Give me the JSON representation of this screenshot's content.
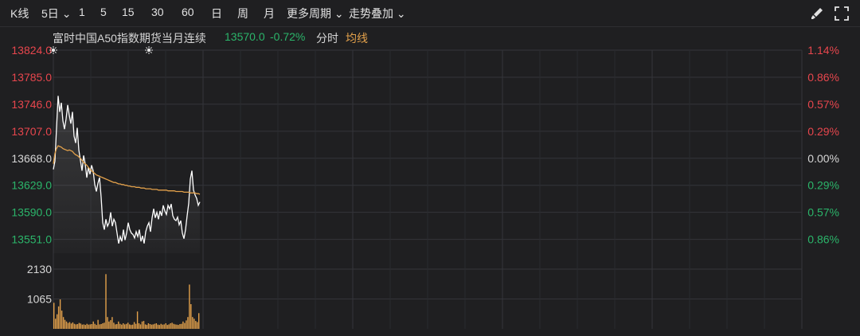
{
  "toolbar": {
    "items": [
      {
        "label": "K线"
      },
      {
        "label": "5日",
        "chevron": true
      },
      {
        "label": "1"
      },
      {
        "label": "5"
      },
      {
        "label": "15"
      },
      {
        "label": "30"
      },
      {
        "label": "60"
      },
      {
        "label": "日"
      },
      {
        "label": "周"
      },
      {
        "label": "月"
      },
      {
        "label": "更多周期",
        "chevron": true
      },
      {
        "label": "走势叠加",
        "chevron": true
      }
    ],
    "icons": [
      "brush-icon",
      "fullscreen-icon"
    ]
  },
  "info": {
    "instrument": "富时中国A50指数期货当月连续",
    "price": "13570.0",
    "change": "-0.72%",
    "mode": "分时",
    "ma_label": "均线"
  },
  "colors": {
    "background": "#1f1f21",
    "grid": "#34353a",
    "up": "#e7464d",
    "down": "#2bb56a",
    "price_line": "#ffffff",
    "avg_line": "#e3a14b",
    "volume": "#e3a14b",
    "text": "#d6d6d6"
  },
  "chart_data": {
    "type": "line",
    "price_axis": {
      "ticks": [
        "13824.0",
        "13785.0",
        "13746.0",
        "13707.0",
        "13668.0",
        "13629.0",
        "13590.0",
        "13551.0"
      ],
      "range": [
        13531.0,
        13824.0
      ],
      "prev_close": 13668.0
    },
    "percent_axis": {
      "ticks": [
        "1.14%",
        "0.86%",
        "0.57%",
        "0.29%",
        "0.00%",
        "0.29%",
        "0.57%",
        "0.86%"
      ]
    },
    "volume_axis": {
      "ticks": [
        "2130",
        "1065"
      ],
      "max": 2130
    },
    "sessions": 5,
    "series": [
      {
        "values": [
          13652,
          13664,
          13712,
          13758,
          13735,
          13748,
          13722,
          13710,
          13725,
          13745,
          13730,
          13718,
          13735,
          13700,
          13690,
          13712,
          13680,
          13665,
          13650,
          13672,
          13660,
          13640,
          13655,
          13645,
          13658,
          13650,
          13630,
          13620,
          13632,
          13640,
          13612,
          13575,
          13565,
          13580,
          13570,
          13575,
          13590,
          13570,
          13580,
          13575,
          13560,
          13545,
          13555,
          13548,
          13565,
          13550,
          13560,
          13575,
          13565,
          13560,
          13558,
          13553,
          13562,
          13555,
          13565,
          13548,
          13556,
          13545,
          13562,
          13570,
          13575,
          13562,
          13582,
          13595,
          13582,
          13590,
          13580,
          13592,
          13585,
          13600,
          13592,
          13587,
          13600,
          13595,
          13602,
          13585,
          13580,
          13578,
          13583,
          13572,
          13578,
          13560,
          13552,
          13565,
          13585,
          13603,
          13638,
          13650,
          13622,
          13615,
          13610,
          13600,
          13605
        ]
      },
      {
        "values": [
          13660,
          13675,
          13682,
          13686,
          13685,
          13684,
          13682,
          13681,
          13680,
          13679,
          13680,
          13679,
          13678,
          13675,
          13673,
          13672,
          13670,
          13668,
          13665,
          13662,
          13660,
          13658,
          13655,
          13652,
          13650,
          13648,
          13646,
          13644,
          13643,
          13642,
          13641,
          13640,
          13639,
          13638,
          13637,
          13636,
          13635,
          13634,
          13633,
          13633,
          13632,
          13631,
          13631,
          13630,
          13630,
          13629,
          13629,
          13628,
          13628,
          13627,
          13627,
          13627,
          13626,
          13626,
          13626,
          13625,
          13625,
          13625,
          13624,
          13624,
          13624,
          13624,
          13623,
          13623,
          13623,
          13623,
          13622,
          13622,
          13622,
          13622,
          13622,
          13622,
          13621,
          13621,
          13621,
          13621,
          13621,
          13620,
          13620,
          13620,
          13620,
          13620,
          13619,
          13619,
          13619,
          13619,
          13618,
          13618,
          13618,
          13618,
          13617,
          13617,
          13616
        ]
      }
    ],
    "volume": [
      930,
      360,
      520,
      800,
      1050,
      650,
      420,
      320,
      260,
      210,
      240,
      190,
      230,
      180,
      160,
      170,
      210,
      190,
      150,
      160,
      140,
      180,
      150,
      160,
      170,
      260,
      180,
      140,
      320,
      160,
      170,
      200,
      220,
      1950,
      420,
      260,
      310,
      420,
      220,
      160,
      170,
      260,
      180,
      150,
      200,
      160,
      180,
      220,
      160,
      140,
      150,
      240,
      180,
      620,
      200,
      160,
      260,
      280,
      160,
      140,
      200,
      170,
      150,
      160,
      180,
      200,
      150,
      140,
      180,
      150,
      160,
      200,
      140,
      160,
      200,
      220,
      180,
      160,
      150,
      140,
      170,
      180,
      260,
      210,
      300,
      420,
      1580,
      880,
      420,
      360,
      280,
      240,
      560
    ]
  }
}
